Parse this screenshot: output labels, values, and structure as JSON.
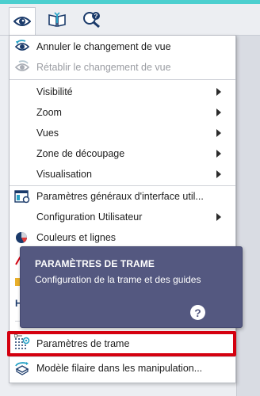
{
  "toolbar": {
    "buttons": [
      {
        "name": "view-eye-icon"
      },
      {
        "name": "book-icon"
      },
      {
        "name": "help-search-icon"
      }
    ]
  },
  "menu": {
    "items": {
      "undo_view": "Annuler le changement de vue",
      "redo_view": "Rétablir le changement de vue",
      "visibility": "Visibilité",
      "zoom": "Zoom",
      "views": "Vues",
      "clip_zone": "Zone de découpage",
      "visualisation": "Visualisation",
      "general_ui": "Paramètres généraux d'interface util...",
      "user_config": "Configuration Utilisateur",
      "colors_lines": "Couleurs et lignes",
      "grid_params": "Paramètres de trame",
      "wireframe": "Modèle filaire dans les manipulation..."
    }
  },
  "tooltip": {
    "title": "PARAMÈTRES DE TRAME",
    "description": "Configuration de la trame et des guides",
    "help_symbol": "?"
  },
  "colors": {
    "accent": "#4ccfcf",
    "tooltip_bg": "#545880",
    "highlight": "#d4000f"
  }
}
